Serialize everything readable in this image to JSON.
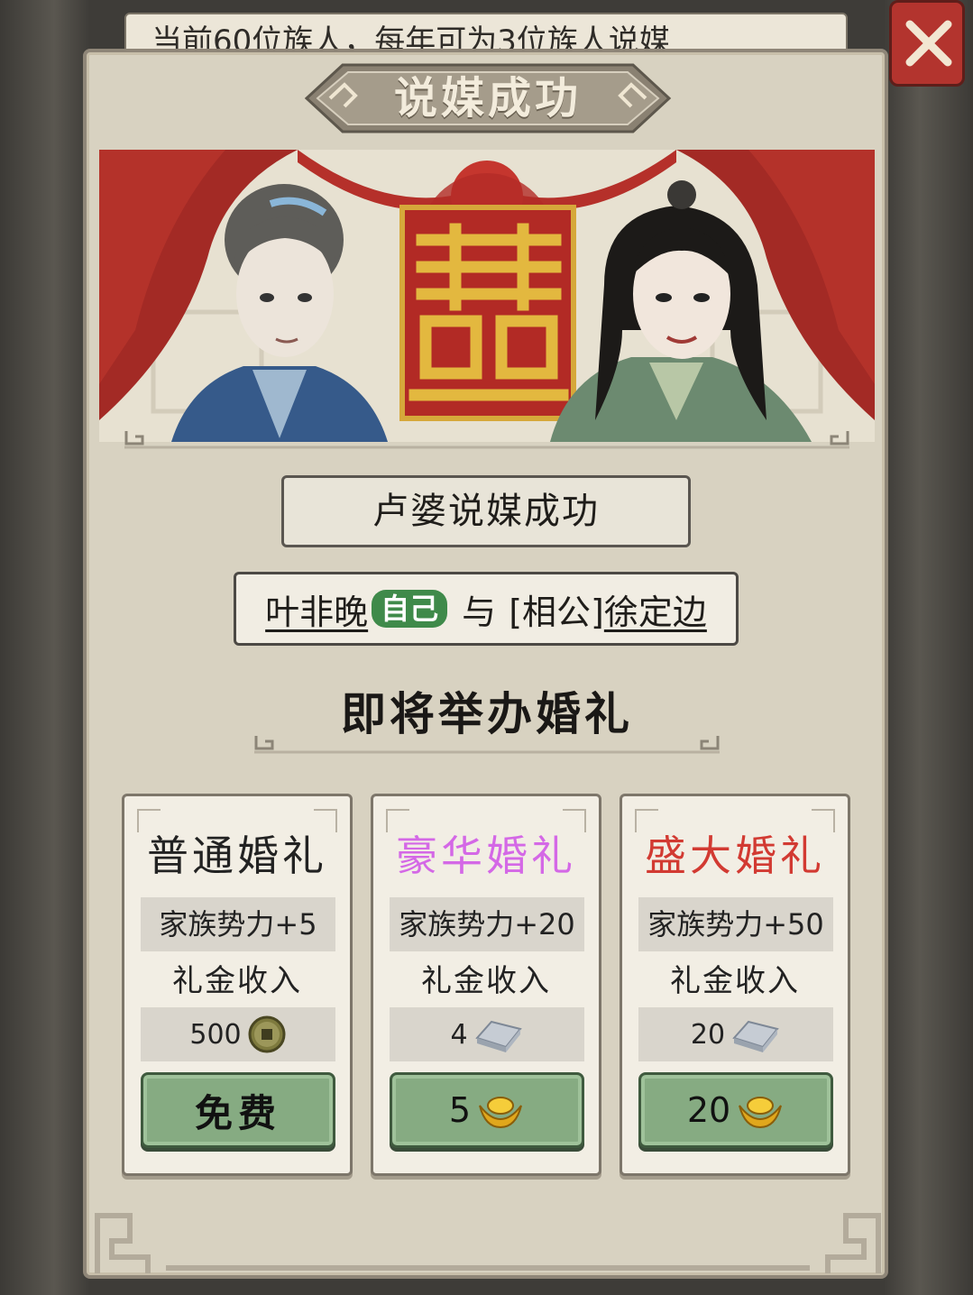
{
  "background_notice": "当前60位族人，每年可为3位族人说媒",
  "dialog": {
    "title": "说媒成功",
    "matchmaker_result": "卢婆说媒成功",
    "couple": {
      "person_a": "叶非晚",
      "person_a_badge": "自己",
      "connector": "与",
      "person_b_relation": "[相公]",
      "person_b": "徐定边"
    },
    "upcoming": "即将举办婚礼",
    "weddings": [
      {
        "name": "普通婚礼",
        "name_color": "#222222",
        "stat": "家族势力+5",
        "income_label": "礼金收入",
        "income_value": "500",
        "income_icon": "copper-coin-icon",
        "cost_label": "免费",
        "cost_icon": ""
      },
      {
        "name": "豪华婚礼",
        "name_color": "#d468e6",
        "stat": "家族势力+20",
        "income_label": "礼金收入",
        "income_value": "4",
        "income_icon": "silver-ingot-icon",
        "cost_label": "5",
        "cost_icon": "gold-ingot-icon"
      },
      {
        "name": "盛大婚礼",
        "name_color": "#d23a32",
        "stat": "家族势力+50",
        "income_label": "礼金收入",
        "income_value": "20",
        "income_icon": "silver-ingot-icon",
        "cost_label": "20",
        "cost_icon": "gold-ingot-icon"
      }
    ]
  }
}
